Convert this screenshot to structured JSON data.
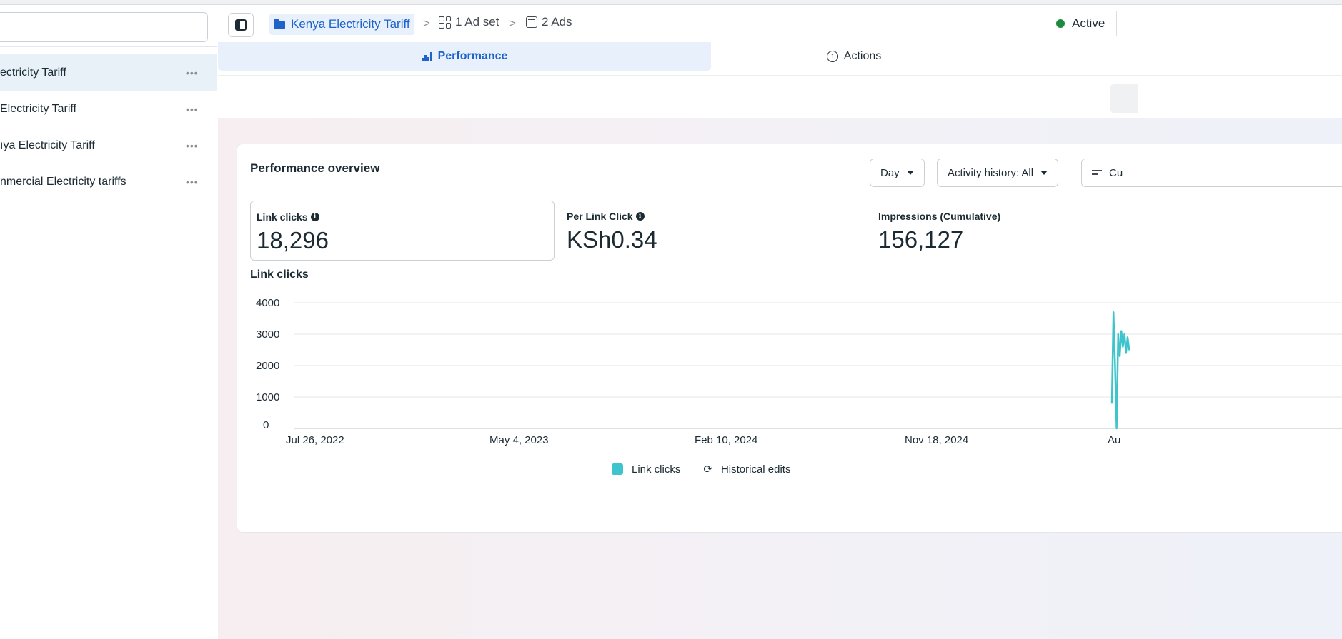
{
  "sidebar": {
    "items": [
      {
        "label": "ectricity Tariff",
        "active": true
      },
      {
        "label": "Electricity Tariff",
        "active": false
      },
      {
        "label": "ıya Electricity Tariff",
        "active": false
      },
      {
        "label": "nmercial Electricity tariffs",
        "active": false
      }
    ],
    "more_glyph": "•••"
  },
  "breadcrumb": {
    "campaign": "Kenya Electricity Tariff",
    "adset": "1 Ad set",
    "ads": "2 Ads",
    "separator": ">"
  },
  "status": {
    "label": "Active",
    "color": "#1e8a3e"
  },
  "tabs": {
    "performance": "Performance",
    "actions": "Actions"
  },
  "overview": {
    "title": "Performance overview",
    "dropdown_day": "Day",
    "dropdown_activity": "Activity history: All",
    "dropdown_customize": "Cu",
    "metrics": [
      {
        "label": "Link clicks",
        "value": "18,296",
        "info": true
      },
      {
        "label": "Per Link Click",
        "value": "KSh0.34",
        "info": true
      },
      {
        "label": "Impressions (Cumulative)",
        "value": "156,127",
        "info": false
      }
    ]
  },
  "chart_data": {
    "type": "line",
    "title": "Link clicks",
    "xlabel": "",
    "ylabel": "",
    "ylim": [
      0,
      4000
    ],
    "yticks": [
      "0",
      "1000",
      "2000",
      "3000",
      "4000"
    ],
    "xticks": [
      "Jul 26, 2022",
      "May 4, 2023",
      "Feb 10, 2024",
      "Nov 18, 2024",
      "Au"
    ],
    "grid": true,
    "legend": "bottom-center",
    "series": [
      {
        "name": "Link clicks",
        "color": "#3dc4cc",
        "x": [
          "2025-07-30",
          "2025-07-31",
          "2025-08-01",
          "2025-08-02",
          "2025-08-03",
          "2025-08-04",
          "2025-08-05",
          "2025-08-06",
          "2025-08-07",
          "2025-08-08",
          "2025-08-09",
          "2025-08-10"
        ],
        "values": [
          800,
          3700,
          2000,
          0,
          3000,
          2300,
          3100,
          2600,
          3000,
          2400,
          2900,
          2500
        ]
      }
    ],
    "legend_items": [
      "Link clicks",
      "Historical edits"
    ]
  }
}
